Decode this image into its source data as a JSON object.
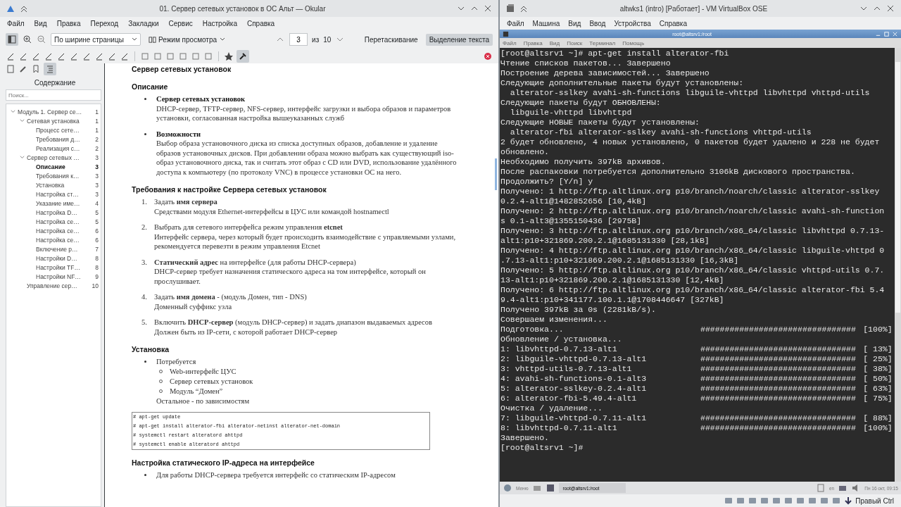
{
  "okular": {
    "title": "01. Сервер сетевых установок в ОС Альт — Okular",
    "menu": [
      "Файл",
      "Вид",
      "Правка",
      "Переход",
      "Закладки",
      "Сервис",
      "Настройка",
      "Справка"
    ],
    "toolbar": {
      "zoom": "По ширине страницы",
      "view_mode": "Режим просмотра",
      "page": "3",
      "of": "из",
      "total": "10",
      "tools": [
        {
          "label": "Перетаскивание",
          "selected": false
        },
        {
          "label": "Выделение текста",
          "selected": true
        }
      ]
    },
    "sidebar": {
      "title": "Содержание",
      "search": {
        "placeholder": "Поиск..."
      },
      "toc": [
        {
          "label": "Модуль 1. Сервер се…",
          "page": "1",
          "selected": false,
          "children": [
            {
              "label": "Сетевая установка",
              "page": "1",
              "selected": false,
              "children": [
                {
                  "label": "Процесс сете…",
                  "page": "1",
                  "selected": false
                },
                {
                  "label": "Требования д…",
                  "page": "2",
                  "selected": false
                },
                {
                  "label": "Реализация с…",
                  "page": "2",
                  "selected": false
                }
              ]
            },
            {
              "label": "Сервер сетевых …",
              "page": "3",
              "selected": false,
              "children": [
                {
                  "label": "Описание",
                  "page": "3",
                  "selected": true
                },
                {
                  "label": "Требования к…",
                  "page": "3",
                  "selected": false
                },
                {
                  "label": "Установка",
                  "page": "3",
                  "selected": false
                },
                {
                  "label": "Настройка ст…",
                  "page": "3",
                  "selected": false
                },
                {
                  "label": "Указание име…",
                  "page": "4",
                  "selected": false
                },
                {
                  "label": "Настройка D…",
                  "page": "5",
                  "selected": false
                },
                {
                  "label": "Настройка се…",
                  "page": "5",
                  "selected": false
                },
                {
                  "label": "Настройка се…",
                  "page": "6",
                  "selected": false
                },
                {
                  "label": "Настройка се…",
                  "page": "6",
                  "selected": false
                },
                {
                  "label": "Включение р…",
                  "page": "7",
                  "selected": false
                },
                {
                  "label": "Настройки D…",
                  "page": "8",
                  "selected": false
                },
                {
                  "label": "Настройки TF…",
                  "page": "8",
                  "selected": false
                },
                {
                  "label": "Настройки NF…",
                  "page": "9",
                  "selected": false
                }
              ]
            },
            {
              "label": "Управление сер…",
              "page": "10",
              "selected": false
            }
          ]
        }
      ]
    },
    "document": {
      "blocks": [
        {
          "kind": "heading",
          "text": "Сервер сетевых установок"
        },
        {
          "kind": "heading",
          "text": "Описание"
        },
        {
          "kind": "bullet",
          "bold": true,
          "title": "Сервер сетевых установок",
          "text": "DHCP-сервер, TFTP-сервер, NFS-сервер, интерфейс загрузки и выбора образов и параметров установки, согласованная настройка вышеуказанных служб"
        },
        {
          "kind": "bullet",
          "bold": true,
          "title": "Возможности",
          "text": "Выбор образа установочного диска из списка доступных образов, добавление и удаление образов установочных дисков. При добавлении образа можно выбрать как существующий iso-образ установочного диска, так и считать этот образ с CD или DVD, использование удалённого доступа к компьютеру (по протоколу VNC) в процессе установки ОС на него."
        },
        {
          "kind": "heading",
          "text": "Требования к настройке Сервера сетевых установок"
        },
        {
          "kind": "numbered",
          "marker": "1.",
          "title": "Задать **имя сервера**",
          "text": "Средствами модуля Ethernet-интерфейсы в ЦУС или командой hostnamectl"
        },
        {
          "kind": "numbered",
          "marker": "2.",
          "title": "Выбрать для сетевого интерфейса режим управления **etcnet**",
          "text": "Интерфейс сервера, через который будет происходить взаимодействие с управляемыми узлами, рекомендуется перевезти в режим управления Etcnet"
        },
        {
          "kind": "numbered",
          "marker": "3.",
          "title": "**Статический адрес** на интерфейсе (для работы DHCP-сервера)",
          "text": "DHCP-сервер требует назначения статического адреса на том интерфейсе, который он прослушивает."
        },
        {
          "kind": "numbered",
          "marker": "4.",
          "title": "Задать **имя домена** - (модуль Домен, тип - DNS)",
          "text": "Доменный суффикс узла"
        },
        {
          "kind": "numbered",
          "marker": "5.",
          "title": "Включить **DHCP-сервер** (модуль DHCP-сервер) и задать диапазон выдаваемых адресов",
          "text": "Должен быть из IP-сети, с которой работает DHCP-сервер"
        },
        {
          "kind": "heading",
          "text": "Установка"
        },
        {
          "kind": "bullet",
          "bold": false,
          "title": "Потребуется",
          "items": [
            "Web-интерфейс ЦУС",
            "Сервер сетевых установок",
            "Модуль “Домен”"
          ],
          "text": "Остальное - по зависимостям"
        },
        {
          "kind": "code",
          "lines": [
            "# apt-get update",
            "# apt-get install alterator-fbi alterator-netinst alterator-net-domain",
            "# systemctl restart alteratord  ahttpd",
            "# systemctl enable alteratord ahttpd"
          ]
        },
        {
          "kind": "heading",
          "text": "Настройка статического IP-адреса на интерфейсе"
        },
        {
          "kind": "bullet",
          "bold": false,
          "title": "Для работы DHCP-сервера требуется интерфейс со статическим IP-адресом"
        }
      ]
    }
  },
  "virtualbox": {
    "title": "altwks1 (intro) [Работает] - VM VirtualBox OSE",
    "menu": [
      "Файл",
      "Машина",
      "Вид",
      "Ввод",
      "Устройства",
      "Справка"
    ],
    "guest": {
      "window_title": "root@altsrv1:/root",
      "menu": [
        "Файл",
        "Правка",
        "Вид",
        "Поиск",
        "Терминал",
        "Помощь"
      ],
      "terminal": [
        {
          "kind": "text",
          "text": "[root@altsrv1 ~]# apt-get install alterator-fbi"
        },
        {
          "kind": "text",
          "text": "Чтение списков пакетов... Завершено"
        },
        {
          "kind": "text",
          "text": "Построение дерева зависимостей... Завершено"
        },
        {
          "kind": "text",
          "text": "Следующие дополнительные пакеты будут установлены:"
        },
        {
          "kind": "text",
          "text": "  alterator-sslkey avahi-sh-functions libguile-vhttpd libvhttpd vhttpd-utils"
        },
        {
          "kind": "text",
          "text": "Следующие пакеты будут ОБНОВЛЕНЫ:"
        },
        {
          "kind": "text",
          "text": "  libguile-vhttpd libvhttpd"
        },
        {
          "kind": "text",
          "text": "Следующие НОВЫЕ пакеты будут установлены:"
        },
        {
          "kind": "text",
          "text": "  alterator-fbi alterator-sslkey avahi-sh-functions vhttpd-utils"
        },
        {
          "kind": "text",
          "text": "2 будет обновлено, 4 новых установлено, 0 пакетов будет удалено и 228 не будет"
        },
        {
          "kind": "text",
          "text": "обновлено."
        },
        {
          "kind": "text",
          "text": "Необходимо получить 397kB архивов."
        },
        {
          "kind": "text",
          "text": "После распаковки потребуется дополнительно 3106kB дискового пространства."
        },
        {
          "kind": "text",
          "text": "Продолжить? [Y/n] y"
        },
        {
          "kind": "text",
          "text": "Получено: 1 http://ftp.altlinux.org p10/branch/noarch/classic alterator-sslkey"
        },
        {
          "kind": "text",
          "text": "0.2.4-alt1@1482852656 [10,4kB]"
        },
        {
          "kind": "text",
          "text": "Получено: 2 http://ftp.altlinux.org p10/branch/noarch/classic avahi-sh-function"
        },
        {
          "kind": "text",
          "text": "s 0.1-alt3@1355150436 [2975B]"
        },
        {
          "kind": "text",
          "text": "Получено: 3 http://ftp.altlinux.org p10/branch/x86_64/classic libvhttpd 0.7.13-"
        },
        {
          "kind": "text",
          "text": "alt1:p10+321869.200.2.1@1685131330 [28,1kB]"
        },
        {
          "kind": "text",
          "text": "Получено: 4 http://ftp.altlinux.org p10/branch/x86_64/classic libguile-vhttpd 0"
        },
        {
          "kind": "text",
          "text": ".7.13-alt1:p10+321869.200.2.1@1685131330 [16,3kB]"
        },
        {
          "kind": "text",
          "text": "Получено: 5 http://ftp.altlinux.org p10/branch/x86_64/classic vhttpd-utils 0.7."
        },
        {
          "kind": "text",
          "text": "13-alt1:p10+321869.200.2.1@1685131330 [12,4kB]"
        },
        {
          "kind": "text",
          "text": "Получено: 6 http://ftp.altlinux.org p10/branch/x86_64/classic alterator-fbi 5.4"
        },
        {
          "kind": "text",
          "text": "9.4-alt1:p10+341177.100.1.1@1708446647 [327kB]"
        },
        {
          "kind": "text",
          "text": "Получено 397kB за 0s (2281kB/s)."
        },
        {
          "kind": "text",
          "text": "Совершаем изменения..."
        },
        {
          "kind": "progress",
          "label": "Подготовка...",
          "bar": "################################",
          "percent": "[100%]"
        },
        {
          "kind": "text",
          "text": "Обновление / установка..."
        },
        {
          "kind": "progress",
          "label": "1: libvhttpd-0.7.13-alt1",
          "bar": "################################",
          "percent": "[ 13%]"
        },
        {
          "kind": "progress",
          "label": "2: libguile-vhttpd-0.7.13-alt1",
          "bar": "################################",
          "percent": "[ 25%]"
        },
        {
          "kind": "progress",
          "label": "3: vhttpd-utils-0.7.13-alt1",
          "bar": "################################",
          "percent": "[ 38%]"
        },
        {
          "kind": "progress",
          "label": "4: avahi-sh-functions-0.1-alt3",
          "bar": "################################",
          "percent": "[ 50%]"
        },
        {
          "kind": "progress",
          "label": "5: alterator-sslkey-0.2.4-alt1",
          "bar": "################################",
          "percent": "[ 63%]"
        },
        {
          "kind": "progress",
          "label": "6: alterator-fbi-5.49.4-alt1",
          "bar": "################################",
          "percent": "[ 75%]"
        },
        {
          "kind": "text",
          "text": "Очистка / удаление..."
        },
        {
          "kind": "progress",
          "label": "7: libguile-vhttpd-0.7.11-alt1",
          "bar": "################################",
          "percent": "[ 88%]"
        },
        {
          "kind": "progress",
          "label": "8: libvhttpd-0.7.11-alt1",
          "bar": "################################",
          "percent": "[100%]"
        },
        {
          "kind": "text",
          "text": "Завершено."
        },
        {
          "kind": "text",
          "text": "[root@altsrv1 ~]#"
        }
      ],
      "taskbar": {
        "menu_label": "Меню",
        "task": "root@altsrv1:/root",
        "layout": "en",
        "clock": "Пн 16 окт, 09:15"
      }
    },
    "host_key": "Правый Ctrl"
  }
}
